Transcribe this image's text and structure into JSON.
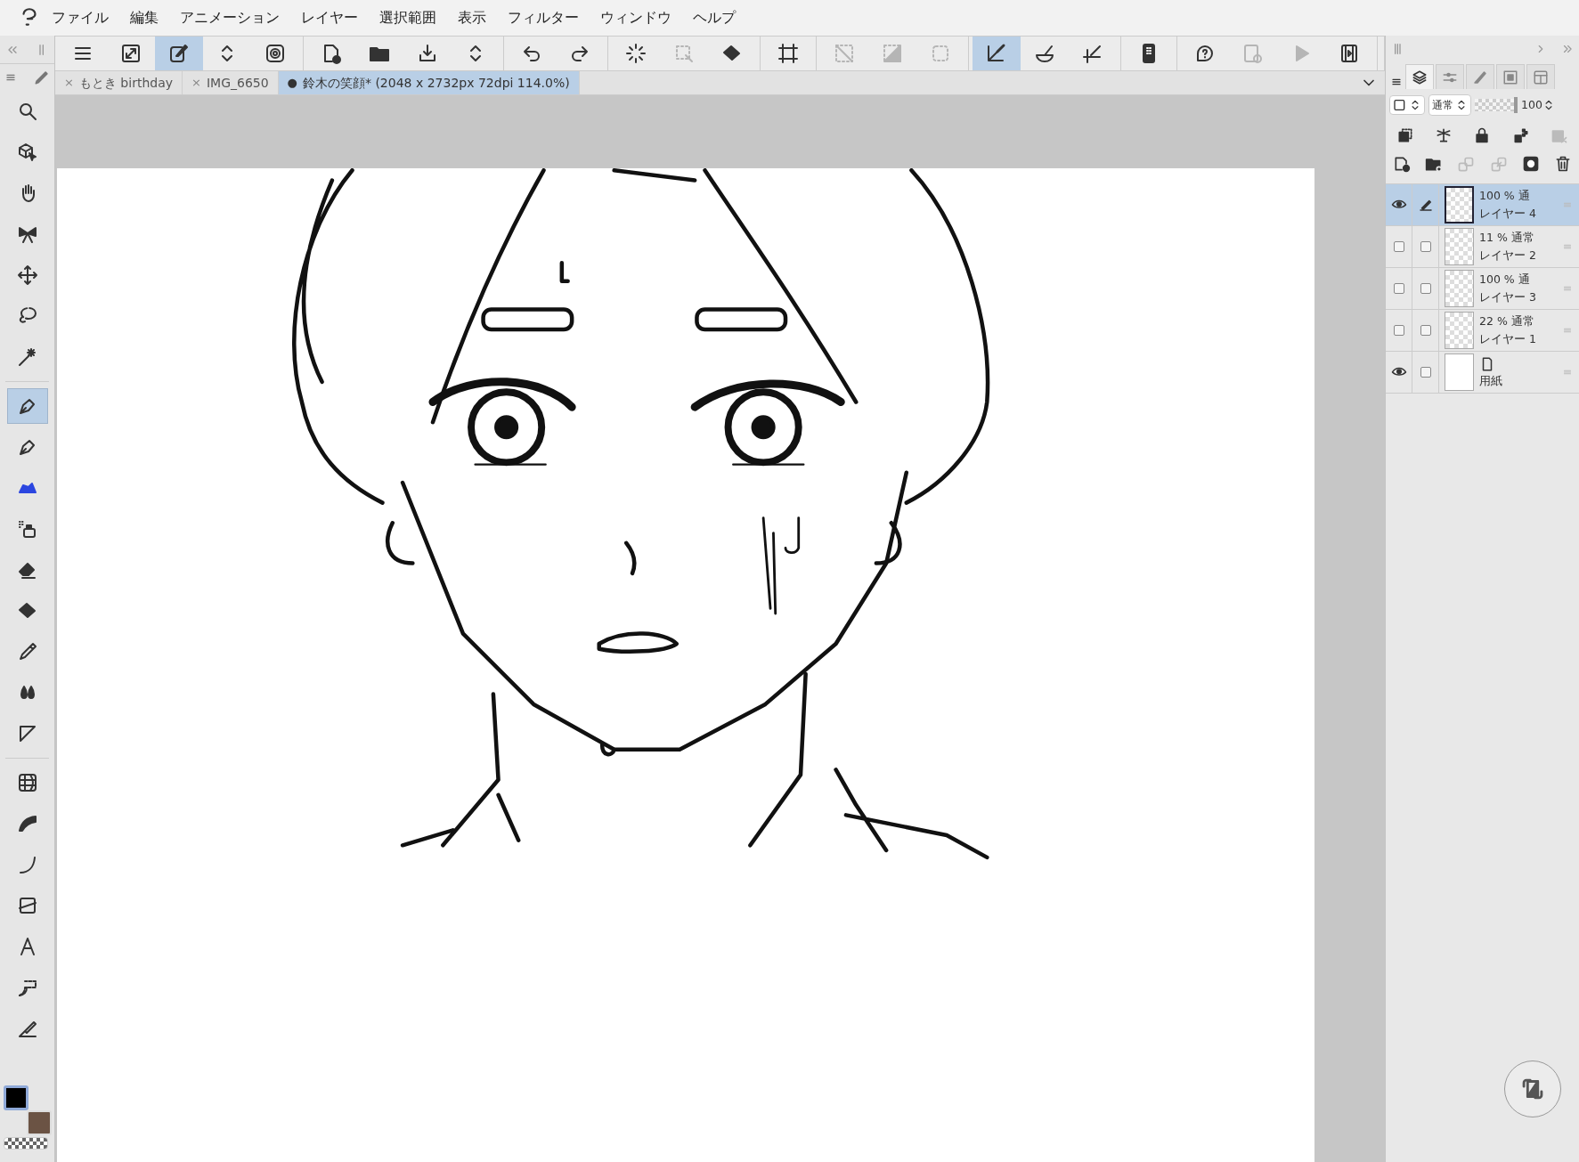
{
  "menu": [
    "ファイル",
    "編集",
    "アニメーション",
    "レイヤー",
    "選択範囲",
    "表示",
    "フィルター",
    "ウィンドウ",
    "ヘルプ"
  ],
  "toolbar": [
    [
      {
        "selected": false,
        "disabled": false
      },
      {
        "selected": false,
        "disabled": false
      },
      {
        "selected": true,
        "disabled": false
      },
      {
        "selected": false,
        "disabled": false
      },
      {
        "selected": false,
        "disabled": false
      }
    ],
    [
      {
        "selected": false,
        "disabled": false
      },
      {
        "selected": false,
        "disabled": false
      },
      {
        "selected": false,
        "disabled": false
      },
      {
        "selected": false,
        "disabled": false
      }
    ],
    [
      {
        "selected": false,
        "disabled": false
      },
      {
        "selected": false,
        "disabled": false
      }
    ],
    [
      {
        "selected": false,
        "disabled": false
      },
      {
        "selected": false,
        "disabled": true
      },
      {
        "selected": false,
        "disabled": false
      }
    ],
    [
      {
        "selected": false,
        "disabled": false
      }
    ],
    [
      {
        "selected": false,
        "disabled": true
      },
      {
        "selected": false,
        "disabled": true
      },
      {
        "selected": false,
        "disabled": true
      }
    ],
    [
      {
        "selected": true,
        "disabled": false
      },
      {
        "selected": false,
        "disabled": false
      },
      {
        "selected": false,
        "disabled": false
      }
    ],
    [
      {
        "selected": false,
        "disabled": false
      }
    ],
    [
      {
        "selected": false,
        "disabled": false
      },
      {
        "selected": false,
        "disabled": true
      },
      {
        "selected": false,
        "disabled": true
      },
      {
        "selected": false,
        "disabled": false
      }
    ]
  ],
  "tabs": [
    {
      "marker": "×",
      "label": "もとき birthday",
      "modified": false,
      "selected": false
    },
    {
      "marker": "×",
      "label": "IMG_6650",
      "modified": false,
      "selected": false
    },
    {
      "marker": "●",
      "label": "鈴木の笑顔* (2048 x 2732px 72dpi 114.0%)",
      "modified": true,
      "selected": true
    }
  ],
  "tools": [
    {
      "selected": false
    },
    {
      "selected": false
    },
    {
      "selected": false
    },
    {
      "selected": false
    },
    {
      "selected": false
    },
    {
      "selected": false
    },
    {
      "selected": false
    },
    {
      "selected": true
    },
    {
      "selected": false
    },
    {
      "selected": false
    },
    {
      "selected": false
    },
    {
      "selected": false
    },
    {
      "selected": false
    },
    {
      "selected": false
    },
    {
      "selected": false
    },
    {
      "selected": false
    },
    {
      "selected": false
    },
    {
      "selected": false
    },
    {
      "selected": false
    },
    {
      "selected": false
    },
    {
      "selected": false
    },
    {
      "selected": false
    },
    {
      "selected": false
    }
  ],
  "color_swatches": [
    {
      "color": "#000000",
      "selected": true
    },
    {
      "color": "#6b5344",
      "selected": false
    }
  ],
  "layer_panel": {
    "tabs": [
      {
        "selected": true
      },
      {
        "selected": false
      },
      {
        "selected": false
      },
      {
        "selected": false
      },
      {
        "selected": false
      }
    ],
    "blend_mode": "通常",
    "opacity_slider": {
      "level": 1
    },
    "opacity": "100",
    "layers": [
      {
        "kind": "raster",
        "opacity": "100 %",
        "blend": "通",
        "name": "レイヤー 4",
        "visible": true,
        "editing": true,
        "selected": true
      },
      {
        "kind": "raster",
        "opacity": "11 %",
        "blend": "通常",
        "name": "レイヤー 2",
        "visible": false,
        "editing": false,
        "selected": false
      },
      {
        "kind": "raster",
        "opacity": "100 %",
        "blend": "通",
        "name": "レイヤー 3",
        "visible": false,
        "editing": false,
        "selected": false
      },
      {
        "kind": "raster",
        "opacity": "22 %",
        "blend": "通常",
        "name": "レイヤー 1",
        "visible": false,
        "editing": false,
        "selected": false
      },
      {
        "kind": "paper",
        "name": "用紙",
        "visible": true,
        "editing": false,
        "selected": false
      }
    ]
  }
}
